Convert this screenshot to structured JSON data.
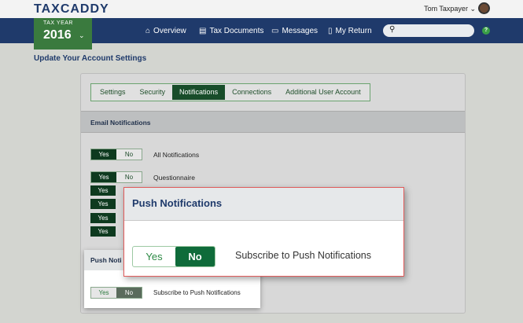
{
  "header": {
    "logo": "TAXCADDY",
    "user_name": "Tom Taxpayer",
    "user_chevron": "⌄"
  },
  "nav": {
    "tax_year_label": "TAX YEAR",
    "tax_year": "2016",
    "tax_year_chevron": "⌄",
    "links": [
      {
        "label": "Overview",
        "icon": "home-icon"
      },
      {
        "label": "Tax Documents",
        "icon": "document-icon"
      },
      {
        "label": "Messages",
        "icon": "message-icon"
      },
      {
        "label": "My Return",
        "icon": "return-icon"
      }
    ],
    "search_placeholder": "",
    "help": "?"
  },
  "page": {
    "title": "Update Your Account Settings"
  },
  "tabs": [
    {
      "label": "Settings",
      "active": false
    },
    {
      "label": "Security",
      "active": false
    },
    {
      "label": "Notifications",
      "active": true
    },
    {
      "label": "Connections",
      "active": false
    },
    {
      "label": "Additional User Account",
      "active": false
    }
  ],
  "email_section": {
    "title": "Email Notifications",
    "yes": "Yes",
    "no": "No",
    "rows": [
      {
        "label": "All Notifications",
        "value": "Yes"
      },
      {
        "label": "Questionnaire",
        "value": "Yes"
      }
    ],
    "hidden_rows_yes": [
      "Yes",
      "Yes",
      "Yes",
      "Yes"
    ]
  },
  "push_background": {
    "title_partial": "Push Noti",
    "yes": "Yes",
    "no": "No",
    "label": "Subscribe to Push Notifications",
    "value": "No"
  },
  "popup": {
    "title": "Push Notifications",
    "yes": "Yes",
    "no": "No",
    "label": "Subscribe to Push Notifications",
    "value": "No"
  },
  "colors": {
    "nav_bg": "#1f3a6b",
    "tax_year_bg": "#3a7a3e",
    "toggle_active": "#0e3a1f",
    "popup_no": "#0f6b3a",
    "popup_border": "#e05b5b"
  }
}
